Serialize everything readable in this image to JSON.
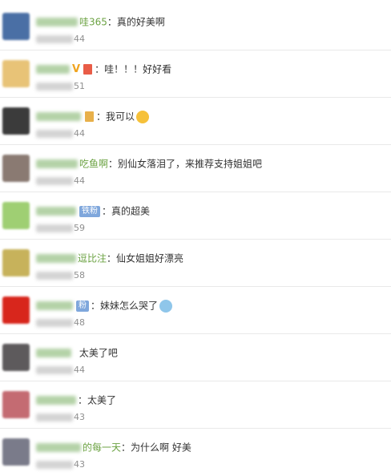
{
  "comments": [
    {
      "name": "哇365",
      "badge": "",
      "text": "真的好美啊",
      "time_suffix": "44",
      "avatar_color": "#4a6fa5"
    },
    {
      "name": "",
      "badge": "",
      "text": "哇！！！好好看",
      "time_suffix": "51",
      "avatar_color": "#e8c377"
    },
    {
      "name": "",
      "badge": "",
      "text": "我可以",
      "time_suffix": "44",
      "avatar_color": "#3b3b3b"
    },
    {
      "name": "吃鱼啊",
      "badge": "",
      "text": "别仙女落泪了，来推荐支持姐姐吧",
      "time_suffix": "44",
      "avatar_color": "#8a7a72"
    },
    {
      "name": "",
      "badge": "铁粉",
      "text": "真的超美",
      "time_suffix": "59",
      "avatar_color": "#9fcf73"
    },
    {
      "name": "逗比注",
      "badge": "",
      "text": "仙女姐姐好漂亮",
      "time_suffix": "58",
      "avatar_color": "#c7b25b"
    },
    {
      "name": "",
      "badge": "粉",
      "text": "妹妹怎么哭了",
      "time_suffix": "48",
      "avatar_color": "#d8261c"
    },
    {
      "name": "",
      "badge": "",
      "text": "太美了吧",
      "time_suffix": "44",
      "avatar_color": "#5d5a5c"
    },
    {
      "name": "",
      "badge": "",
      "text": "太美了",
      "time_suffix": "43",
      "avatar_color": "#c46b72"
    },
    {
      "name": "的每一天",
      "badge": "",
      "text": "为什么啊 好美",
      "time_suffix": "43",
      "avatar_color": "#7a7b8a"
    }
  ]
}
